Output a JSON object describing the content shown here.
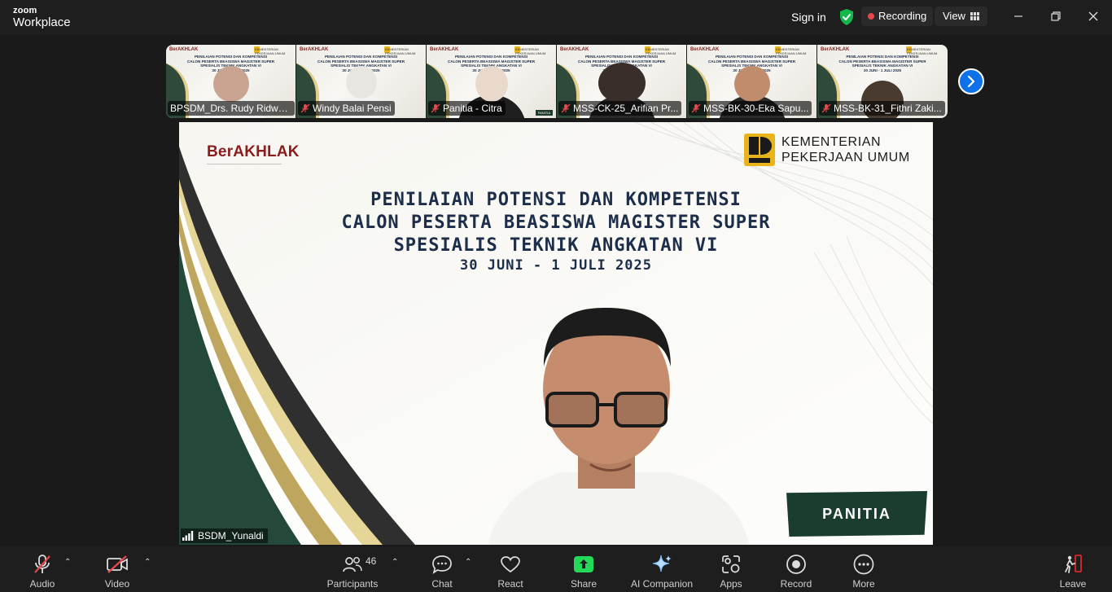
{
  "app": {
    "brand_top": "zoom",
    "brand_bottom": "Workplace"
  },
  "titlebar": {
    "sign_in": "Sign in",
    "recording": "Recording",
    "view": "View"
  },
  "thumbnails": [
    {
      "name": "BPSDM_Drs. Rudy Ridwa...",
      "muted": false,
      "slide_title": "PENILAIAN POTENSI DAN KOMPETENSI\nCALON PESERTA BEASISWA MAGISTER SUPER\nSPESIALIS TEKNIK ANGKATAN VI\n30 JUNI - 1 JULI 2025"
    },
    {
      "name": "Windy Balai Pensi",
      "muted": true,
      "slide_title": "PENILAIAN POTENSI DAN KOMPETENSI\nCALON PESERTA BEASISWA MAGISTER SUPER\nSPESIALIS TEKNIK ANGKATAN VI\n30 JUNI - 1 JULI 2025"
    },
    {
      "name": "Panitia - Citra",
      "muted": true,
      "slide_title": "PENILAIAN POTENSI DAN KOMPETENSI\nCALON PESERTA BEASISWA MAGISTER SUPER\nSPESIALIS TEKNIK ANGKATAN VI\n30 JUNI - 1 JULI 2025"
    },
    {
      "name": "MSS-CK-25_Arifian Pr...",
      "muted": true,
      "slide_title": "PENILAIAN POTENSI DAN KOMPETENSI\nCALON PESERTA BEASISWA MAGISTER SUPER\nSPESIALIS TEKNIK ANGKATAN VI\n30 JUNI - 1 JULI 2025"
    },
    {
      "name": "MSS-BK-30-Eka Sapu...",
      "muted": true,
      "slide_title": "PENILAIAN POTENSI DAN KOMPETENSI\nCALON PESERTA BEASISWA MAGISTER SUPER\nSPESIALIS TEKNIK ANGKATAN VI\n30 JUNI - 1 JULI 2025"
    },
    {
      "name": "MSS-BK-31_Fithri Zaki...",
      "muted": true,
      "slide_title": "PENILAIAN POTENSI DAN KOMPETENSI\nCALON PESERTA BEASISWA MAGISTER SUPER\nSPESIALIS TEKNIK ANGKATAN VI\n30 JUNI - 1 JULI 2025"
    }
  ],
  "main_video": {
    "brand_logo": "BerAKHLAK",
    "ministry_line1": "KEMENTERIAN",
    "ministry_line2": "PEKERJAAN UMUM",
    "title_line1": "PENILAIAN POTENSI DAN KOMPETENSI",
    "title_line2": "CALON PESERTA BEASISWA MAGISTER SUPER",
    "title_line3": "SPESIALIS TEKNIK ANGKATAN VI",
    "date_line": "30 JUNI - 1 JULI 2025",
    "badge": "PANITIA",
    "speaker_name": "BSDM_Yunaldi"
  },
  "toolbar": {
    "audio": "Audio",
    "video": "Video",
    "participants": "Participants",
    "participant_count": "46",
    "chat": "Chat",
    "react": "React",
    "share": "Share",
    "ai_companion": "AI Companion",
    "apps": "Apps",
    "record": "Record",
    "more": "More",
    "leave": "Leave"
  },
  "colors": {
    "share_green": "#23d959",
    "accent_blue": "#0e71eb",
    "muted_red": "#e5484d",
    "leave_red": "#e02828",
    "shield_green": "#14b84a",
    "badge_green": "#1b3d2f",
    "slide_title_navy": "#1c2e4a"
  }
}
